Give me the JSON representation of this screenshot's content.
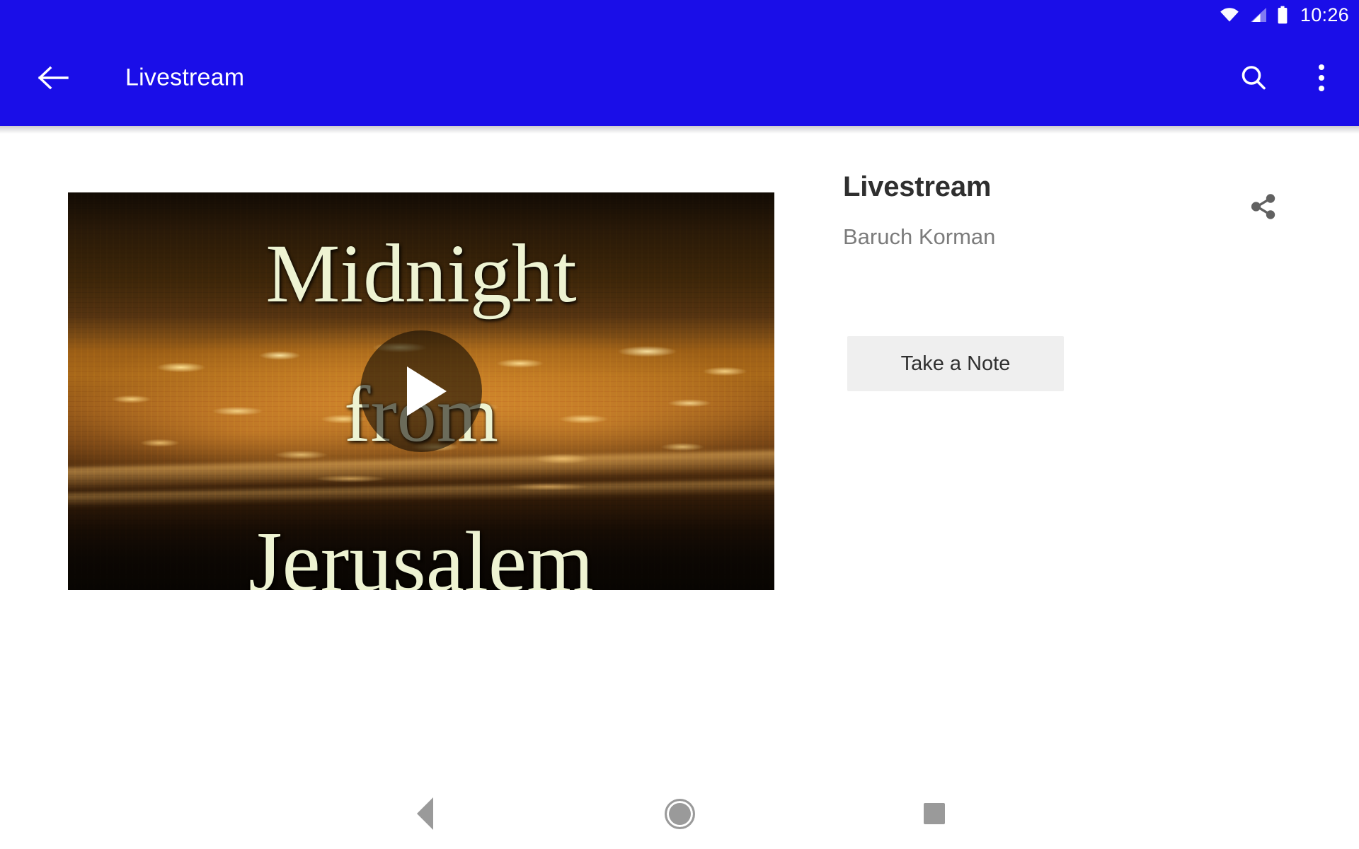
{
  "status_bar": {
    "time": "10:26",
    "icons": [
      "wifi-icon",
      "cellular-signal-icon",
      "battery-icon"
    ]
  },
  "app_bar": {
    "title": "Livestream",
    "back_icon": "back-arrow-icon",
    "search_icon": "search-icon",
    "overflow_icon": "overflow-menu-icon",
    "background_color": "#1a0ee8",
    "text_color": "#ffffff"
  },
  "video": {
    "thumbnail_title_lines": [
      "Midnight",
      "from",
      "Jerusalem"
    ],
    "play_icon": "play-button-icon",
    "alt": "Night cityscape of Jerusalem with golden lights"
  },
  "info": {
    "title": "Livestream",
    "author": "Baruch Korman",
    "share_icon": "share-icon",
    "note_button_label": "Take a Note",
    "note_button_color": "#efefef",
    "title_color": "#2f2f2f",
    "author_color": "#7b7b7b",
    "share_icon_color": "#616161"
  },
  "nav_bar": {
    "back_label": "Back",
    "home_label": "Home",
    "recents_label": "Recents",
    "back_icon": "nav-back-triangle-icon",
    "home_icon": "nav-home-circle-icon",
    "recents_icon": "nav-recents-square-icon",
    "icon_color": "#9a9a9a"
  }
}
